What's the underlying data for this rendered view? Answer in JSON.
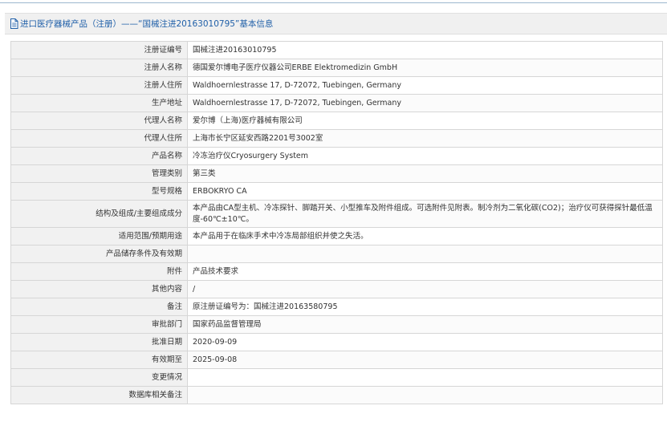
{
  "header": {
    "title": "进口医疗器械产品（注册）——“国械注进20163010795”基本信息"
  },
  "rows": [
    {
      "label": "注册证编号",
      "value": "国械注进20163010795"
    },
    {
      "label": "注册人名称",
      "value": "德国爱尔博电子医疗仪器公司ERBE Elektromedizin GmbH"
    },
    {
      "label": "注册人住所",
      "value": "Waldhoernlestrasse 17, D-72072, Tuebingen, Germany"
    },
    {
      "label": "生产地址",
      "value": "Waldhoernlestrasse 17, D-72072, Tuebingen, Germany"
    },
    {
      "label": "代理人名称",
      "value": "爱尔博（上海)医疗器械有限公司"
    },
    {
      "label": "代理人住所",
      "value": "上海市长宁区延安西路2201号3002室"
    },
    {
      "label": "产品名称",
      "value": "冷冻治疗仪Cryosurgery System"
    },
    {
      "label": "管理类别",
      "value": "第三类"
    },
    {
      "label": "型号规格",
      "value": "ERBOKRYO CA"
    },
    {
      "label": "结构及组成/主要组成成分",
      "value": "本产品由CA型主机、冷冻探针、脚踏开关、小型推车及附件组成。可选附件见附表。制冷剂为二氧化碳(CO2)；治疗仪可获得探针最低温度-60℃±10℃。"
    },
    {
      "label": "适用范围/预期用途",
      "value": "本产品用于在临床手术中冷冻局部组织并使之失活。"
    },
    {
      "label": "产品储存条件及有效期",
      "value": ""
    },
    {
      "label": "附件",
      "value": "产品技术要求"
    },
    {
      "label": "其他内容",
      "value": "/"
    },
    {
      "label": "备注",
      "value": "原注册证编号为：国械注进20163580795"
    },
    {
      "label": "审批部门",
      "value": "国家药品监督管理局"
    },
    {
      "label": "批准日期",
      "value": "2020-09-09"
    },
    {
      "label": "有效期至",
      "value": "2025-09-08"
    },
    {
      "label": "变更情况",
      "value": ""
    },
    {
      "label": "数据库相关备注",
      "value": ""
    }
  ],
  "colors": {
    "header_text": "#1f5fa8",
    "header_bg": "#f0f0f0",
    "label_bg": "#f1f1f1",
    "border": "#d6d6d6"
  },
  "icons": {
    "header_icon": "document-icon"
  }
}
